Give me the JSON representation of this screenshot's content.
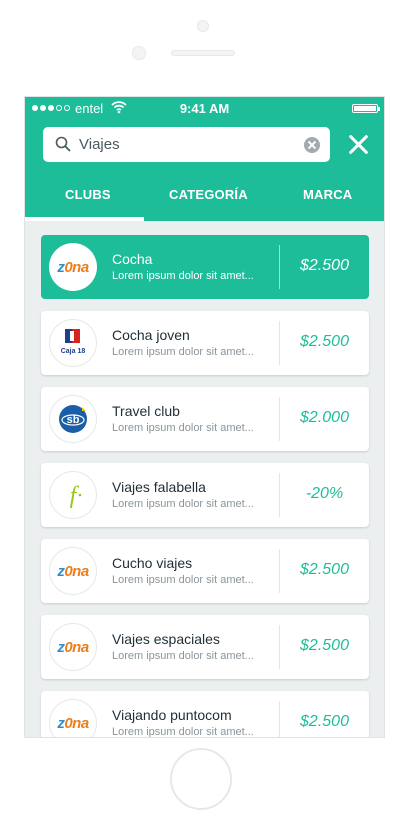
{
  "status_bar": {
    "carrier": "entel",
    "time": "9:41 AM"
  },
  "search": {
    "query": "Viajes"
  },
  "tabs": [
    {
      "label": "CLUBS",
      "active": true
    },
    {
      "label": "CATEGORÍA",
      "active": false
    },
    {
      "label": "MARCA",
      "active": false
    }
  ],
  "items": [
    {
      "logo": "zona-logo",
      "title": "Cocha",
      "subtitle": "Lorem ipsum dolor sit amet...",
      "price": "$2.500",
      "selected": true
    },
    {
      "logo": "caja18-logo",
      "logo_text": "Caja 18",
      "title": "Cocha joven",
      "subtitle": "Lorem ipsum dolor sit amet...",
      "price": "$2.500"
    },
    {
      "logo": "sb-logo",
      "logo_text": "sb",
      "title": "Travel club",
      "subtitle": "Lorem ipsum dolor sit amet...",
      "price": "$2.000"
    },
    {
      "logo": "falabella-logo",
      "logo_text": "f",
      "title": "Viajes falabella",
      "subtitle": "Lorem ipsum dolor sit amet...",
      "price": "-20%"
    },
    {
      "logo": "zona-logo",
      "title": "Cucho viajes",
      "subtitle": "Lorem ipsum dolor sit amet...",
      "price": "$2.500"
    },
    {
      "logo": "zona-logo",
      "title": "Viajes espaciales",
      "subtitle": "Lorem ipsum dolor sit amet...",
      "price": "$2.500"
    },
    {
      "logo": "zona-logo",
      "title": "Viajando puntocom",
      "subtitle": "Lorem ipsum dolor sit amet...",
      "price": "$2.500"
    }
  ],
  "zona_logo": {
    "z": "z",
    "rest": "0na"
  },
  "colors": {
    "accent": "#1dbd99",
    "background": "#ecefef",
    "zona_blue": "#2a8fd4",
    "zona_orange": "#f07d1a"
  }
}
